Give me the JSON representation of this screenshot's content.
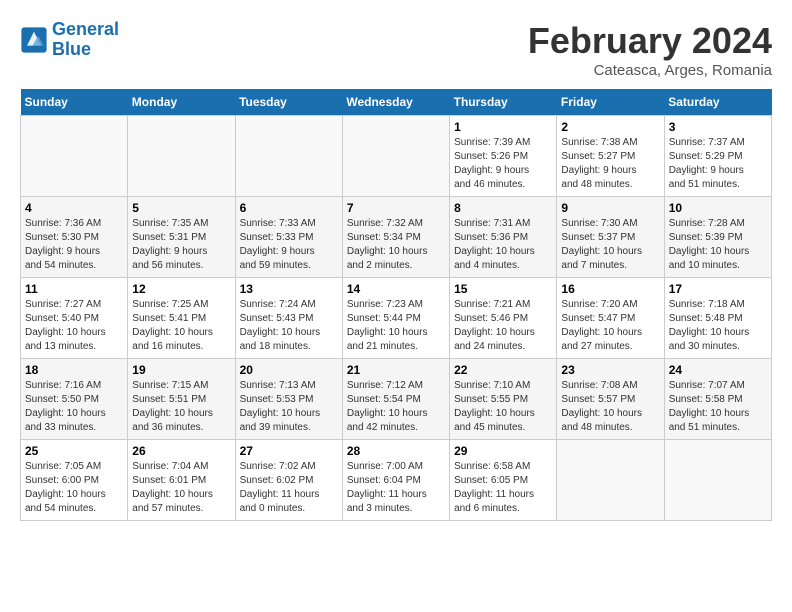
{
  "header": {
    "logo_line1": "General",
    "logo_line2": "Blue",
    "month_year": "February 2024",
    "location": "Cateasca, Arges, Romania"
  },
  "weekdays": [
    "Sunday",
    "Monday",
    "Tuesday",
    "Wednesday",
    "Thursday",
    "Friday",
    "Saturday"
  ],
  "weeks": [
    [
      {
        "day": "",
        "info": ""
      },
      {
        "day": "",
        "info": ""
      },
      {
        "day": "",
        "info": ""
      },
      {
        "day": "",
        "info": ""
      },
      {
        "day": "1",
        "info": "Sunrise: 7:39 AM\nSunset: 5:26 PM\nDaylight: 9 hours\nand 46 minutes."
      },
      {
        "day": "2",
        "info": "Sunrise: 7:38 AM\nSunset: 5:27 PM\nDaylight: 9 hours\nand 48 minutes."
      },
      {
        "day": "3",
        "info": "Sunrise: 7:37 AM\nSunset: 5:29 PM\nDaylight: 9 hours\nand 51 minutes."
      }
    ],
    [
      {
        "day": "4",
        "info": "Sunrise: 7:36 AM\nSunset: 5:30 PM\nDaylight: 9 hours\nand 54 minutes."
      },
      {
        "day": "5",
        "info": "Sunrise: 7:35 AM\nSunset: 5:31 PM\nDaylight: 9 hours\nand 56 minutes."
      },
      {
        "day": "6",
        "info": "Sunrise: 7:33 AM\nSunset: 5:33 PM\nDaylight: 9 hours\nand 59 minutes."
      },
      {
        "day": "7",
        "info": "Sunrise: 7:32 AM\nSunset: 5:34 PM\nDaylight: 10 hours\nand 2 minutes."
      },
      {
        "day": "8",
        "info": "Sunrise: 7:31 AM\nSunset: 5:36 PM\nDaylight: 10 hours\nand 4 minutes."
      },
      {
        "day": "9",
        "info": "Sunrise: 7:30 AM\nSunset: 5:37 PM\nDaylight: 10 hours\nand 7 minutes."
      },
      {
        "day": "10",
        "info": "Sunrise: 7:28 AM\nSunset: 5:39 PM\nDaylight: 10 hours\nand 10 minutes."
      }
    ],
    [
      {
        "day": "11",
        "info": "Sunrise: 7:27 AM\nSunset: 5:40 PM\nDaylight: 10 hours\nand 13 minutes."
      },
      {
        "day": "12",
        "info": "Sunrise: 7:25 AM\nSunset: 5:41 PM\nDaylight: 10 hours\nand 16 minutes."
      },
      {
        "day": "13",
        "info": "Sunrise: 7:24 AM\nSunset: 5:43 PM\nDaylight: 10 hours\nand 18 minutes."
      },
      {
        "day": "14",
        "info": "Sunrise: 7:23 AM\nSunset: 5:44 PM\nDaylight: 10 hours\nand 21 minutes."
      },
      {
        "day": "15",
        "info": "Sunrise: 7:21 AM\nSunset: 5:46 PM\nDaylight: 10 hours\nand 24 minutes."
      },
      {
        "day": "16",
        "info": "Sunrise: 7:20 AM\nSunset: 5:47 PM\nDaylight: 10 hours\nand 27 minutes."
      },
      {
        "day": "17",
        "info": "Sunrise: 7:18 AM\nSunset: 5:48 PM\nDaylight: 10 hours\nand 30 minutes."
      }
    ],
    [
      {
        "day": "18",
        "info": "Sunrise: 7:16 AM\nSunset: 5:50 PM\nDaylight: 10 hours\nand 33 minutes."
      },
      {
        "day": "19",
        "info": "Sunrise: 7:15 AM\nSunset: 5:51 PM\nDaylight: 10 hours\nand 36 minutes."
      },
      {
        "day": "20",
        "info": "Sunrise: 7:13 AM\nSunset: 5:53 PM\nDaylight: 10 hours\nand 39 minutes."
      },
      {
        "day": "21",
        "info": "Sunrise: 7:12 AM\nSunset: 5:54 PM\nDaylight: 10 hours\nand 42 minutes."
      },
      {
        "day": "22",
        "info": "Sunrise: 7:10 AM\nSunset: 5:55 PM\nDaylight: 10 hours\nand 45 minutes."
      },
      {
        "day": "23",
        "info": "Sunrise: 7:08 AM\nSunset: 5:57 PM\nDaylight: 10 hours\nand 48 minutes."
      },
      {
        "day": "24",
        "info": "Sunrise: 7:07 AM\nSunset: 5:58 PM\nDaylight: 10 hours\nand 51 minutes."
      }
    ],
    [
      {
        "day": "25",
        "info": "Sunrise: 7:05 AM\nSunset: 6:00 PM\nDaylight: 10 hours\nand 54 minutes."
      },
      {
        "day": "26",
        "info": "Sunrise: 7:04 AM\nSunset: 6:01 PM\nDaylight: 10 hours\nand 57 minutes."
      },
      {
        "day": "27",
        "info": "Sunrise: 7:02 AM\nSunset: 6:02 PM\nDaylight: 11 hours\nand 0 minutes."
      },
      {
        "day": "28",
        "info": "Sunrise: 7:00 AM\nSunset: 6:04 PM\nDaylight: 11 hours\nand 3 minutes."
      },
      {
        "day": "29",
        "info": "Sunrise: 6:58 AM\nSunset: 6:05 PM\nDaylight: 11 hours\nand 6 minutes."
      },
      {
        "day": "",
        "info": ""
      },
      {
        "day": "",
        "info": ""
      }
    ]
  ]
}
